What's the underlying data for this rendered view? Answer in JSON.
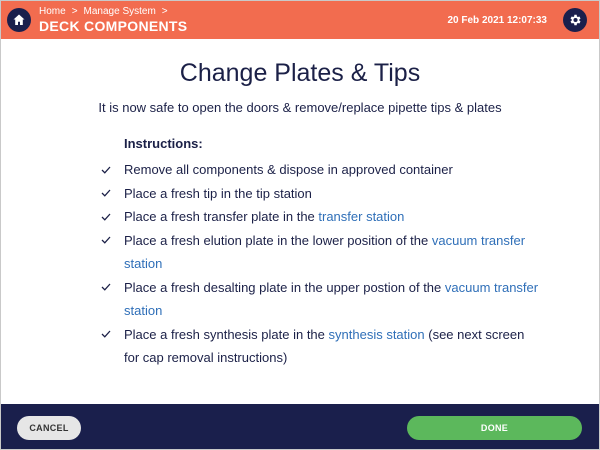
{
  "header": {
    "breadcrumb": [
      "Home",
      "Manage System"
    ],
    "breadcrumb_separator": ">",
    "title": "DECK COMPONENTS",
    "datetime": "20 Feb 2021 12:07:33",
    "home_icon": "home-icon",
    "settings_icon": "gear-icon",
    "color": "#f26c4f"
  },
  "main": {
    "title": "Change Plates & Tips",
    "subtitle": "It is now safe to open the doors & remove/replace pipette tips & plates",
    "instructions_heading": "Instructions:",
    "items": [
      {
        "text": "Remove all components & dispose in approved container"
      },
      {
        "text": "Place a fresh tip in the tip station"
      },
      {
        "text_before": "Place a fresh transfer plate in the ",
        "link": "transfer station",
        "text_after": ""
      },
      {
        "text_before": "Place a fresh elution plate in the lower position of the ",
        "link": "vacuum transfer station",
        "text_after": ""
      },
      {
        "text_before": "Place a fresh desalting plate in the upper postion of the ",
        "link": "vacuum transfer station",
        "text_after": ""
      },
      {
        "text_before": "Place a fresh synthesis plate in the ",
        "link": "synthesis station",
        "text_after": " (see next screen for cap removal instructions)"
      }
    ],
    "link_color": "#2f6fb8",
    "text_color": "#1b2047"
  },
  "footer": {
    "cancel_label": "CANCEL",
    "done_label": "DONE",
    "background": "#1a1f4c",
    "done_color": "#5cb85c"
  }
}
